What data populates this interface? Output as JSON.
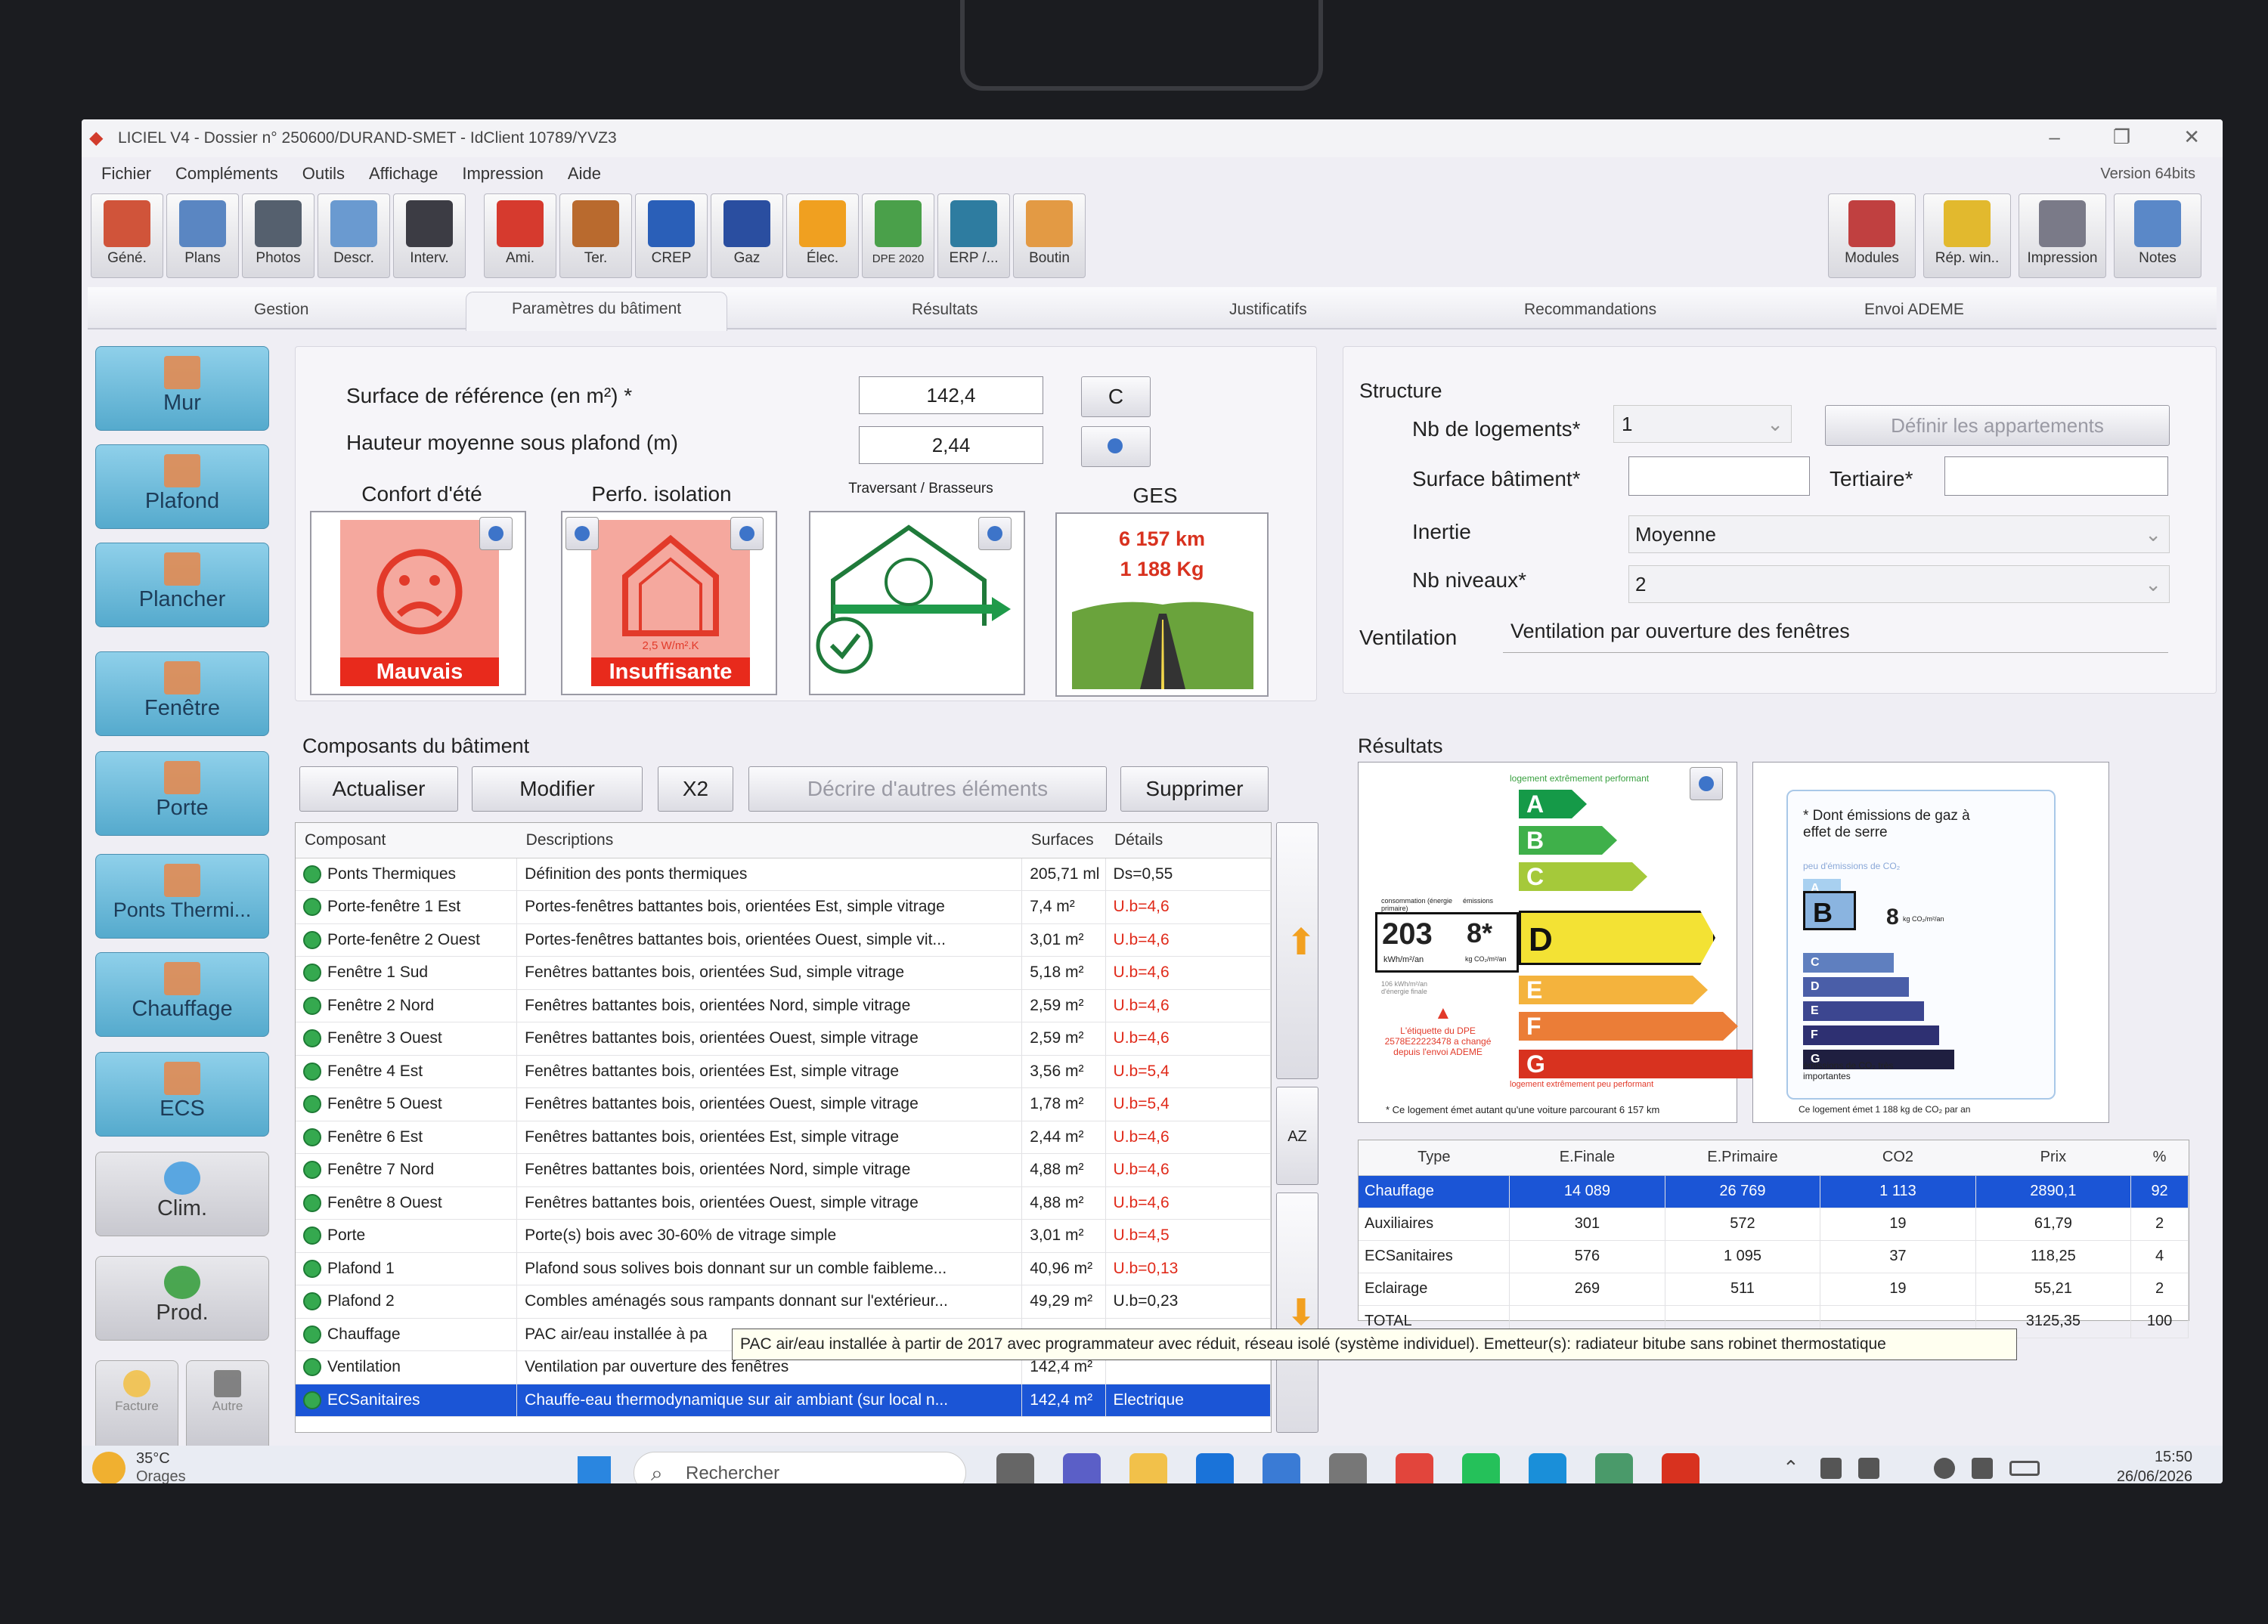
{
  "window": {
    "title": "LICIEL V4 - Dossier n° 250600/DURAND-SMET - IdClient 10789/YVZ3",
    "version": "Version 64bits"
  },
  "menu": [
    "Fichier",
    "Compléments",
    "Outils",
    "Affichage",
    "Impression",
    "Aide"
  ],
  "toolbar_left": [
    {
      "label": "Géné.",
      "icon": "house-icon",
      "color": "#d0543a"
    },
    {
      "label": "Plans",
      "icon": "pencil-plan-icon",
      "color": "#5a86c2"
    },
    {
      "label": "Photos",
      "icon": "camera-icon",
      "color": "#55606e"
    },
    {
      "label": "Descr.",
      "icon": "ruler-icon",
      "color": "#6a9ad0"
    },
    {
      "label": "Interv.",
      "icon": "hardhat-icon",
      "color": "#3c3c44"
    },
    {
      "label": "Ami.",
      "icon": "asbestos-a-icon",
      "color": "#d63a2e"
    },
    {
      "label": "Ter.",
      "icon": "termite-icon",
      "color": "#b96a2e"
    },
    {
      "label": "CREP",
      "icon": "lead-pb-icon",
      "color": "#2a5fb8"
    },
    {
      "label": "Gaz",
      "icon": "gas-flame-icon",
      "color": "#2a4ea0"
    },
    {
      "label": "Élec.",
      "icon": "electric-plug-icon",
      "color": "#f0a020"
    },
    {
      "label": "DPE 2020",
      "icon": "dpe-label-icon",
      "color": "#4aa04a"
    },
    {
      "label": "ERP /...",
      "icon": "factory-icon",
      "color": "#2e7ca0"
    },
    {
      "label": "Boutin",
      "icon": "m2-icon",
      "color": "#e39a44"
    }
  ],
  "toolbar_right": [
    {
      "label": "Modules",
      "icon": "modules-icon",
      "color": "#c04040"
    },
    {
      "label": "Rép. win..",
      "icon": "folder-icon",
      "color": "#e2b92e"
    },
    {
      "label": "Impression",
      "icon": "printer-icon",
      "color": "#7a7a88"
    },
    {
      "label": "Notes",
      "icon": "notes-icon",
      "color": "#5a88c8"
    }
  ],
  "tabs": [
    "Gestion",
    "Paramètres du bâtiment",
    "Résultats",
    "Justificatifs",
    "Recommandations",
    "Envoi ADEME"
  ],
  "sidebar": [
    "Mur",
    "Plafond",
    "Plancher",
    "Fenêtre",
    "Porte",
    "Ponts Thermi...",
    "Chauffage",
    "ECS",
    "Clim.",
    "Prod.",
    "Facture",
    "Autre"
  ],
  "params": {
    "surface_label": "Surface de référence (en m²) *",
    "surface_value": "142,4",
    "c_button": "C",
    "hauteur_label": "Hauteur moyenne sous plafond (m)",
    "hauteur_value": "2,44"
  },
  "indicators": {
    "confort": {
      "title": "Confort d'été",
      "status": "Mauvais"
    },
    "perfo": {
      "title": "Perfo. isolation",
      "value": "2,5 W/m².K",
      "status": "Insuffisante"
    },
    "traversant": {
      "title": "Traversant / Brasseurs"
    },
    "ges": {
      "title": "GES",
      "km": "6 157 km",
      "kg": "1 188 Kg"
    }
  },
  "structure": {
    "title": "Structure",
    "nb_logements_label": "Nb de logements*",
    "nb_logements": "1",
    "definir": "Définir les appartements",
    "surface_batiment_label": "Surface bâtiment*",
    "tertiaire_label": "Tertiaire*",
    "inertie_label": "Inertie",
    "inertie": "Moyenne",
    "nb_niveaux_label": "Nb niveaux*",
    "nb_niveaux": "2",
    "ventilation_label": "Ventilation",
    "ventilation": "Ventilation par ouverture des fenêtres"
  },
  "composants": {
    "title": "Composants du bâtiment",
    "buttons": {
      "actualiser": "Actualiser",
      "modifier": "Modifier",
      "x2": "X2",
      "decrire": "Décrire d'autres éléments",
      "supprimer": "Supprimer"
    },
    "headers": [
      "Composant",
      "Descriptions",
      "Surfaces",
      "Détails"
    ],
    "rows": [
      [
        "Ponts Thermiques",
        "Définition des ponts thermiques",
        "205,71 ml",
        "Ds=0,55"
      ],
      [
        "Porte-fenêtre  1 Est",
        "Portes-fenêtres battantes bois, orientées Est, simple vitrage",
        "7,4 m²",
        "U.b=4,6"
      ],
      [
        "Porte-fenêtre  2 Ouest",
        "Portes-fenêtres battantes bois, orientées Ouest, simple vit...",
        "3,01 m²",
        "U.b=4,6"
      ],
      [
        "Fenêtre  1 Sud",
        "Fenêtres battantes bois, orientées Sud, simple vitrage",
        "5,18 m²",
        "U.b=4,6"
      ],
      [
        "Fenêtre  2 Nord",
        "Fenêtres battantes bois, orientées Nord, simple vitrage",
        "2,59 m²",
        "U.b=4,6"
      ],
      [
        "Fenêtre  3 Ouest",
        "Fenêtres battantes bois, orientées Ouest, simple vitrage",
        "2,59 m²",
        "U.b=4,6"
      ],
      [
        "Fenêtre  4 Est",
        "Fenêtres battantes bois, orientées Est, simple vitrage",
        "3,56 m²",
        "U.b=5,4"
      ],
      [
        "Fenêtre  5 Ouest",
        "Fenêtres battantes bois, orientées Ouest, simple vitrage",
        "1,78 m²",
        "U.b=5,4"
      ],
      [
        "Fenêtre  6 Est",
        "Fenêtres battantes bois, orientées Est, simple vitrage",
        "2,44 m²",
        "U.b=4,6"
      ],
      [
        "Fenêtre  7 Nord",
        "Fenêtres battantes bois, orientées Nord, simple vitrage",
        "4,88 m²",
        "U.b=4,6"
      ],
      [
        "Fenêtre  8 Ouest",
        "Fenêtres battantes bois, orientées Ouest, simple vitrage",
        "4,88 m²",
        "U.b=4,6"
      ],
      [
        "Porte",
        "Porte(s) bois avec 30-60% de vitrage simple",
        "3,01 m²",
        "U.b=4,5"
      ],
      [
        "Plafond  1",
        "Plafond sous solives bois donnant sur un comble faibleme...",
        "40,96 m²",
        "U.b=0,13"
      ],
      [
        "Plafond  2",
        "Combles aménagés sous rampants donnant sur l'extérieur...",
        "49,29 m²",
        "U.b=0,23"
      ],
      [
        "Chauffage",
        "PAC air/eau installée à pa",
        "",
        ""
      ],
      [
        "Ventilation",
        "Ventilation par ouverture des fenêtres",
        "142,4 m²",
        ""
      ],
      [
        "ECSanitaires",
        "Chauffe-eau thermodynamique sur air ambiant (sur local n...",
        "142,4 m²",
        "Electrique"
      ]
    ],
    "tooltip": "PAC air/eau installée à partir de 2017 avec programmateur avec réduit, réseau isolé (système individuel). Emetteur(s): radiateur bitube sans robinet thermostatique",
    "az": "AZ"
  },
  "resultats": {
    "title": "Résultats",
    "dpe": {
      "top_note": "logement extrêmement performant",
      "bottom_note": "logement extrêmement peu performant",
      "value": "203",
      "unit": "kWh/m²/an",
      "ges": "8*",
      "ges_unit": "kg CO₂/m²/an",
      "class": "D",
      "cons_label": "consommation (énergie primaire)",
      "em_label": "émissions",
      "finale": "106 kWh/m²/an d'énergie finale",
      "warning": "L'étiquette du DPE 2578E22223478 a changé depuis l'envoi ADEME",
      "footer": "* Ce logement émet autant qu'une voiture parcourant 6 157 km",
      "classes": [
        "A",
        "B",
        "C",
        "D",
        "E",
        "F",
        "G"
      ]
    },
    "ges_label": {
      "title": "* Dont émissions de gaz à effet de serre",
      "low": "peu d'émissions de CO₂",
      "high": "émissions de CO₂ très importantes",
      "class": "B",
      "value": "8",
      "unit": "kg CO₂/m²/an",
      "footer": "Ce logement émet 1 188 kg de CO₂ par an",
      "classes": [
        "A",
        "B",
        "C",
        "D",
        "E",
        "F",
        "G"
      ]
    },
    "table_headers": [
      "Type",
      "E.Finale",
      "E.Primaire",
      "CO2",
      "Prix",
      "%"
    ],
    "table_rows": [
      [
        "Chauffage",
        "14 089",
        "26 769",
        "1 113",
        "2890,1",
        "92"
      ],
      [
        "Auxiliaires",
        "301",
        "572",
        "19",
        "61,79",
        "2"
      ],
      [
        "ECSanitaires",
        "576",
        "1 095",
        "37",
        "118,25",
        "4"
      ],
      [
        "Eclairage",
        "269",
        "511",
        "19",
        "55,21",
        "2"
      ],
      [
        "TOTAL",
        "",
        "",
        "",
        "3125,35",
        "100"
      ]
    ]
  },
  "taskbar": {
    "weather_temp": "35°C",
    "weather_text": "Orages",
    "search": "Rechercher",
    "time": "15:50",
    "date": "26/06/2026"
  }
}
